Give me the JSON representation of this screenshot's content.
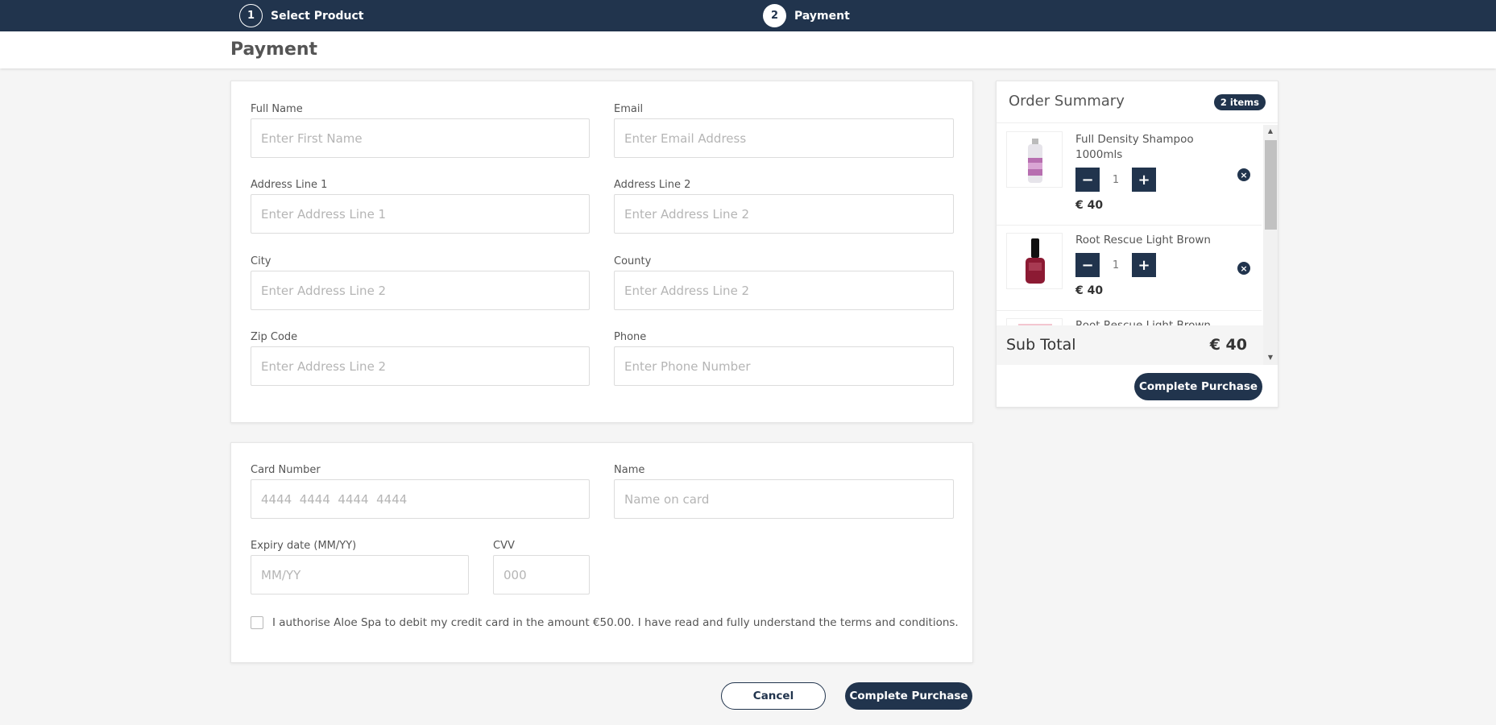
{
  "steps": [
    {
      "number": "1",
      "label": "Select Product"
    },
    {
      "number": "2",
      "label": "Payment"
    }
  ],
  "page_title": "Payment",
  "address_form": {
    "full_name": {
      "label": "Full Name",
      "placeholder": "Enter First Name",
      "value": ""
    },
    "email": {
      "label": "Email",
      "placeholder": "Enter Email Address",
      "value": ""
    },
    "address1": {
      "label": "Address Line 1",
      "placeholder": "Enter Address Line 1",
      "value": ""
    },
    "address2": {
      "label": "Address Line 2",
      "placeholder": "Enter Address Line 2",
      "value": ""
    },
    "city": {
      "label": "City",
      "placeholder": "Enter Address Line 2",
      "value": ""
    },
    "county": {
      "label": "County",
      "placeholder": "Enter Address Line 2",
      "value": ""
    },
    "zip": {
      "label": "Zip Code",
      "placeholder": "Enter Address Line 2",
      "value": ""
    },
    "phone": {
      "label": "Phone",
      "placeholder": "Enter Phone Number",
      "value": ""
    }
  },
  "card_form": {
    "card_number": {
      "label": "Card Number",
      "placeholder": "4444  4444  4444  4444",
      "value": ""
    },
    "name": {
      "label": "Name",
      "placeholder": "Name on card",
      "value": ""
    },
    "expiry": {
      "label": "Expiry date (MM/YY)",
      "placeholder": "MM/YY",
      "value": ""
    },
    "cvv": {
      "label": "CVV",
      "placeholder": "000",
      "value": ""
    },
    "consent_text": "I authorise Aloe Spa to debit my credit card in the amount €50.00. I have read and fully understand the terms and conditions.",
    "consent_checked": false
  },
  "actions": {
    "cancel_label": "Cancel",
    "complete_label": "Complete Purchase"
  },
  "order_summary": {
    "title": "Order Summary",
    "count_badge": "2 items",
    "items": [
      {
        "name": "Full Density Shampoo 1000mls",
        "qty": "1",
        "price": "€ 40",
        "minus": "−",
        "plus": "+",
        "remove": "×"
      },
      {
        "name": "Root Rescue Light Brown",
        "qty": "1",
        "price": "€ 40",
        "minus": "−",
        "plus": "+",
        "remove": "×"
      },
      {
        "name": "Root Rescue Light Brown"
      }
    ],
    "subtotal_label": "Sub Total",
    "subtotal_value": "€ 40",
    "complete_label": "Complete Purchase"
  },
  "colors": {
    "primary": "#21344d",
    "background": "#f5f5f5"
  }
}
